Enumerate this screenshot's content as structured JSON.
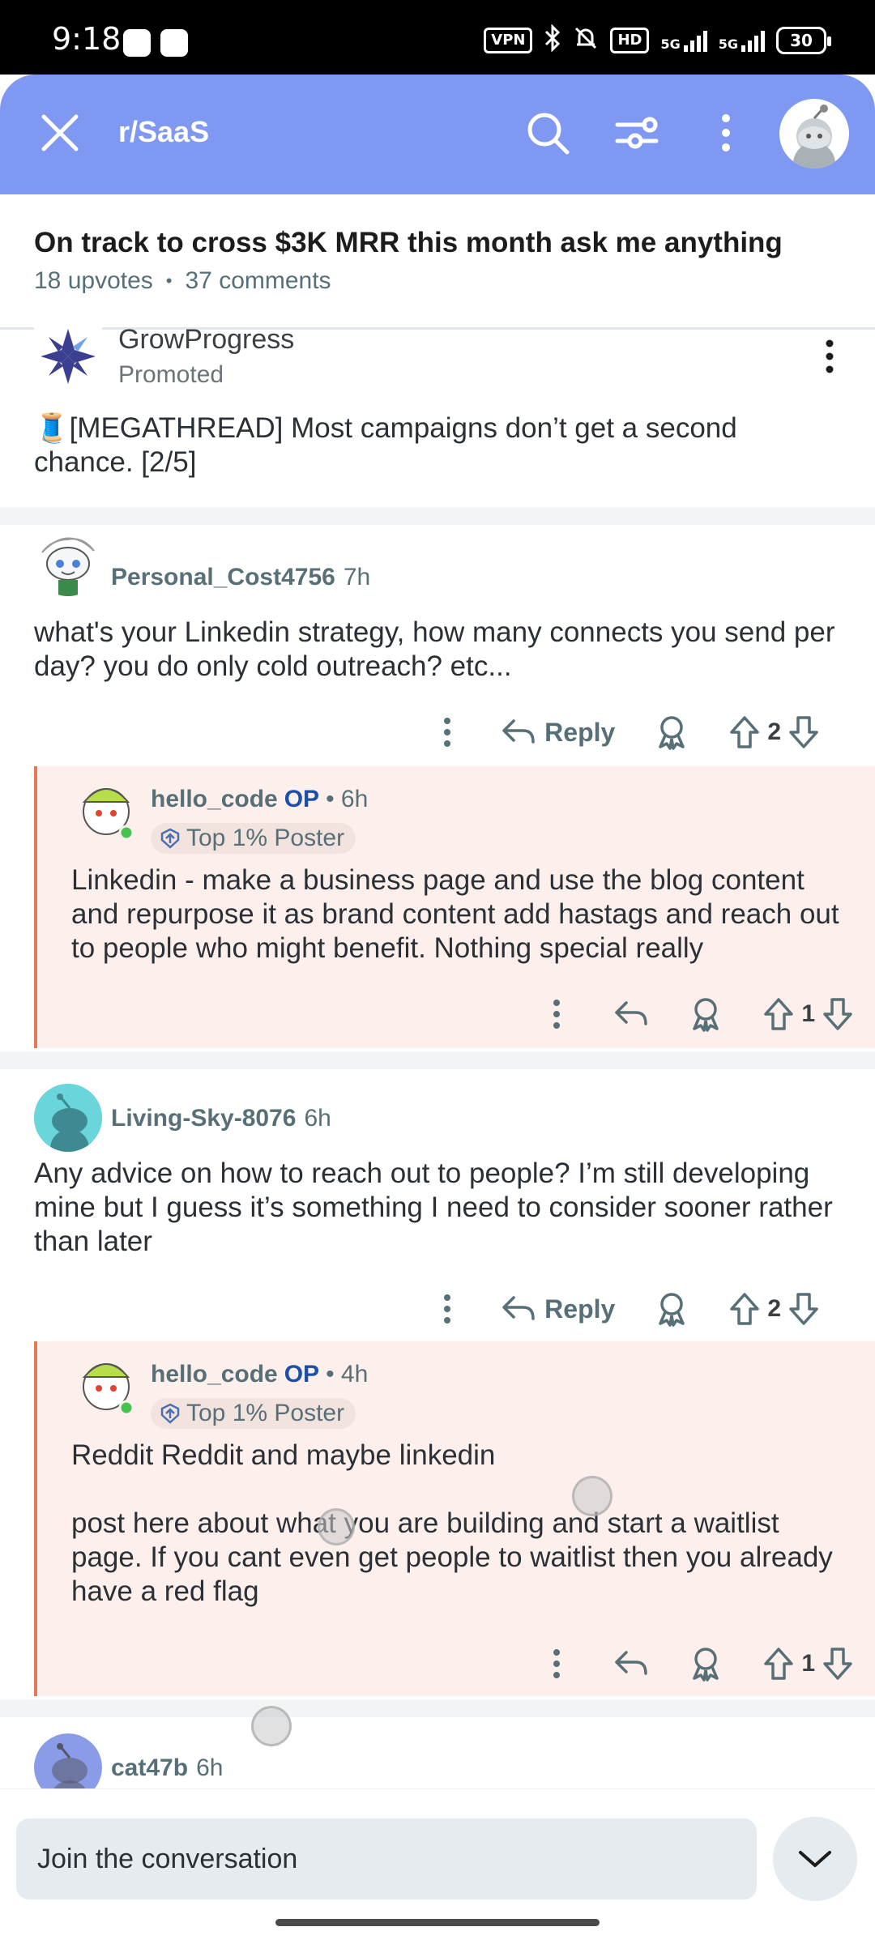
{
  "status_bar": {
    "time": "9:18",
    "vpn": "VPN",
    "hd": "HD",
    "net1": "5G",
    "net2": "5G",
    "battery": "30"
  },
  "header": {
    "subreddit": "r/SaaS",
    "close_icon": "close-icon",
    "search_icon": "search-icon",
    "filter_icon": "sort-filter-icon",
    "more_icon": "more-vertical-icon"
  },
  "post": {
    "title": "On track to cross $3K MRR this month ask me anything",
    "upvotes": "18 upvotes",
    "separator": "•",
    "comments": "37 comments"
  },
  "promoted": {
    "name": "GrowProgress",
    "label": "Promoted",
    "text": "🧵[MEGATHREAD] Most campaigns don’t get a second chance. [2/5]"
  },
  "comments": [
    {
      "user": "Personal_Cost4756",
      "time": "7h",
      "body": "what's your Linkedin strategy, how many connects you send per day? you do only cold outreach? etc...",
      "reply_label": "Reply",
      "votes": "2",
      "reply": {
        "user": "hello_code",
        "op": "OP",
        "time": "• 6h",
        "flair": "Top 1% Poster",
        "body": "Linkedin - make a business page and use the blog content and repurpose it as brand content add hastags and reach out to people who might benefit. Nothing special really",
        "votes": "1"
      }
    },
    {
      "user": "Living-Sky-8076",
      "time": "6h",
      "body": "Any advice on how to reach out to people? I’m still developing mine but I guess it’s something I need to consider sooner rather than later",
      "reply_label": "Reply",
      "votes": "2",
      "reply": {
        "user": "hello_code",
        "op": "OP",
        "time": "• 4h",
        "flair": "Top 1% Poster",
        "body": "Reddit Reddit and maybe linkedin\n\npost here about what you are building and start a waitlist page. If you cant even get people to waitlist then you already have a red flag",
        "votes": "1"
      }
    },
    {
      "user": "cat47b",
      "time": "6h"
    }
  ],
  "bottom": {
    "join_placeholder": "Join the conversation",
    "collapse_icon": "chevron-down-icon"
  },
  "colors": {
    "header": "#7f98f2",
    "reply_bg": "#fdf0ec",
    "reply_border": "#e07a57",
    "op": "#1e4fa8"
  }
}
